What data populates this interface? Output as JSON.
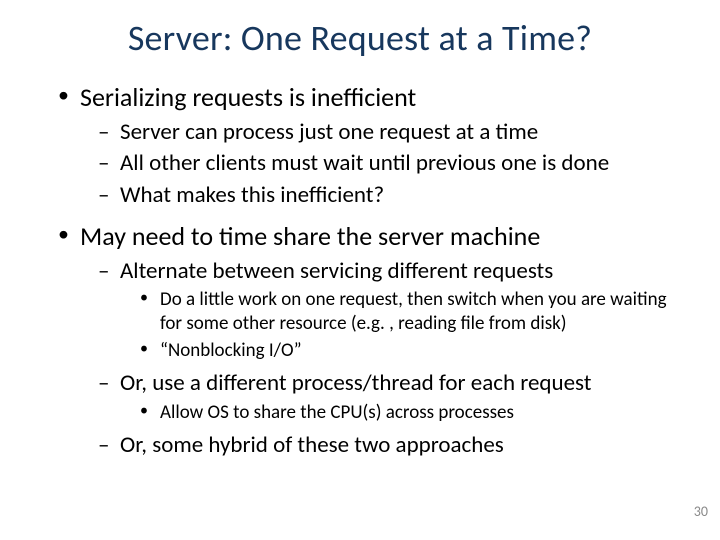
{
  "title": "Server: One Request at a Time?",
  "bullets": [
    {
      "text": "Serializing requests is inefficient",
      "sub": [
        {
          "text": "Server can process just one request at a time"
        },
        {
          "text": "All other clients must wait until previous one is done"
        },
        {
          "text": "What makes this inefficient?"
        }
      ]
    },
    {
      "text": "May need to time share the server machine",
      "sub": [
        {
          "text": "Alternate between servicing different requests",
          "sub": [
            {
              "text": "Do a little work on one request, then switch when you are waiting for some other resource (e.g. , reading file from disk)"
            },
            {
              "text": "“Nonblocking I/O”"
            }
          ]
        },
        {
          "text": "Or, use a different process/thread for each request",
          "sub": [
            {
              "text": "Allow OS to share the CPU(s) across processes"
            }
          ]
        },
        {
          "text": "Or, some hybrid of these two approaches"
        }
      ]
    }
  ],
  "page_number": "30"
}
